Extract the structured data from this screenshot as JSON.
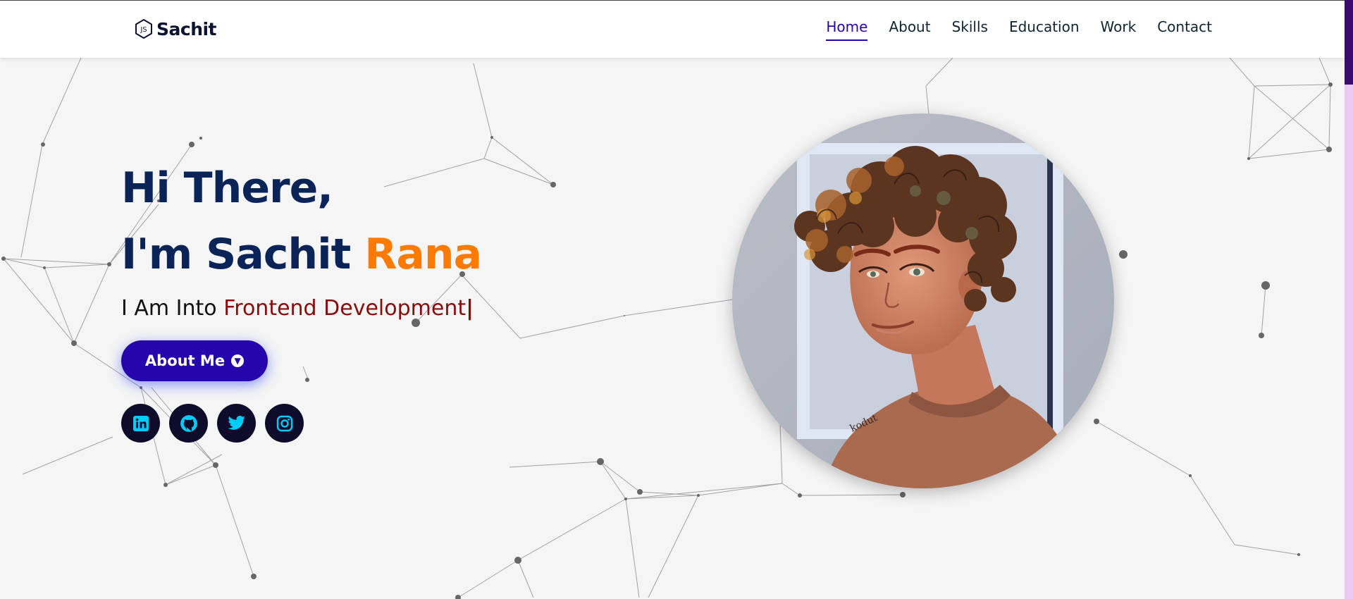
{
  "nav": {
    "logo_text": "Sachit",
    "links": [
      "Home",
      "About",
      "Skills",
      "Education",
      "Work",
      "Contact"
    ],
    "active": "Home"
  },
  "hero": {
    "greeting": "Hi There,",
    "name_prefix": "I'm Sachit",
    "name_accent": "Rana",
    "into_prefix": "I Am Into",
    "into_typed": "Frontend Development",
    "caret": "|",
    "about_button": "About Me"
  },
  "socials": [
    "linkedin-icon",
    "github-icon",
    "twitter-icon",
    "instagram-icon"
  ],
  "colors": {
    "navy": "#0b2457",
    "accent_orange": "#ff7a00",
    "button_blue": "#2506ad",
    "typed_red": "#8a0b0b",
    "social_icon": "#00cbf6"
  }
}
